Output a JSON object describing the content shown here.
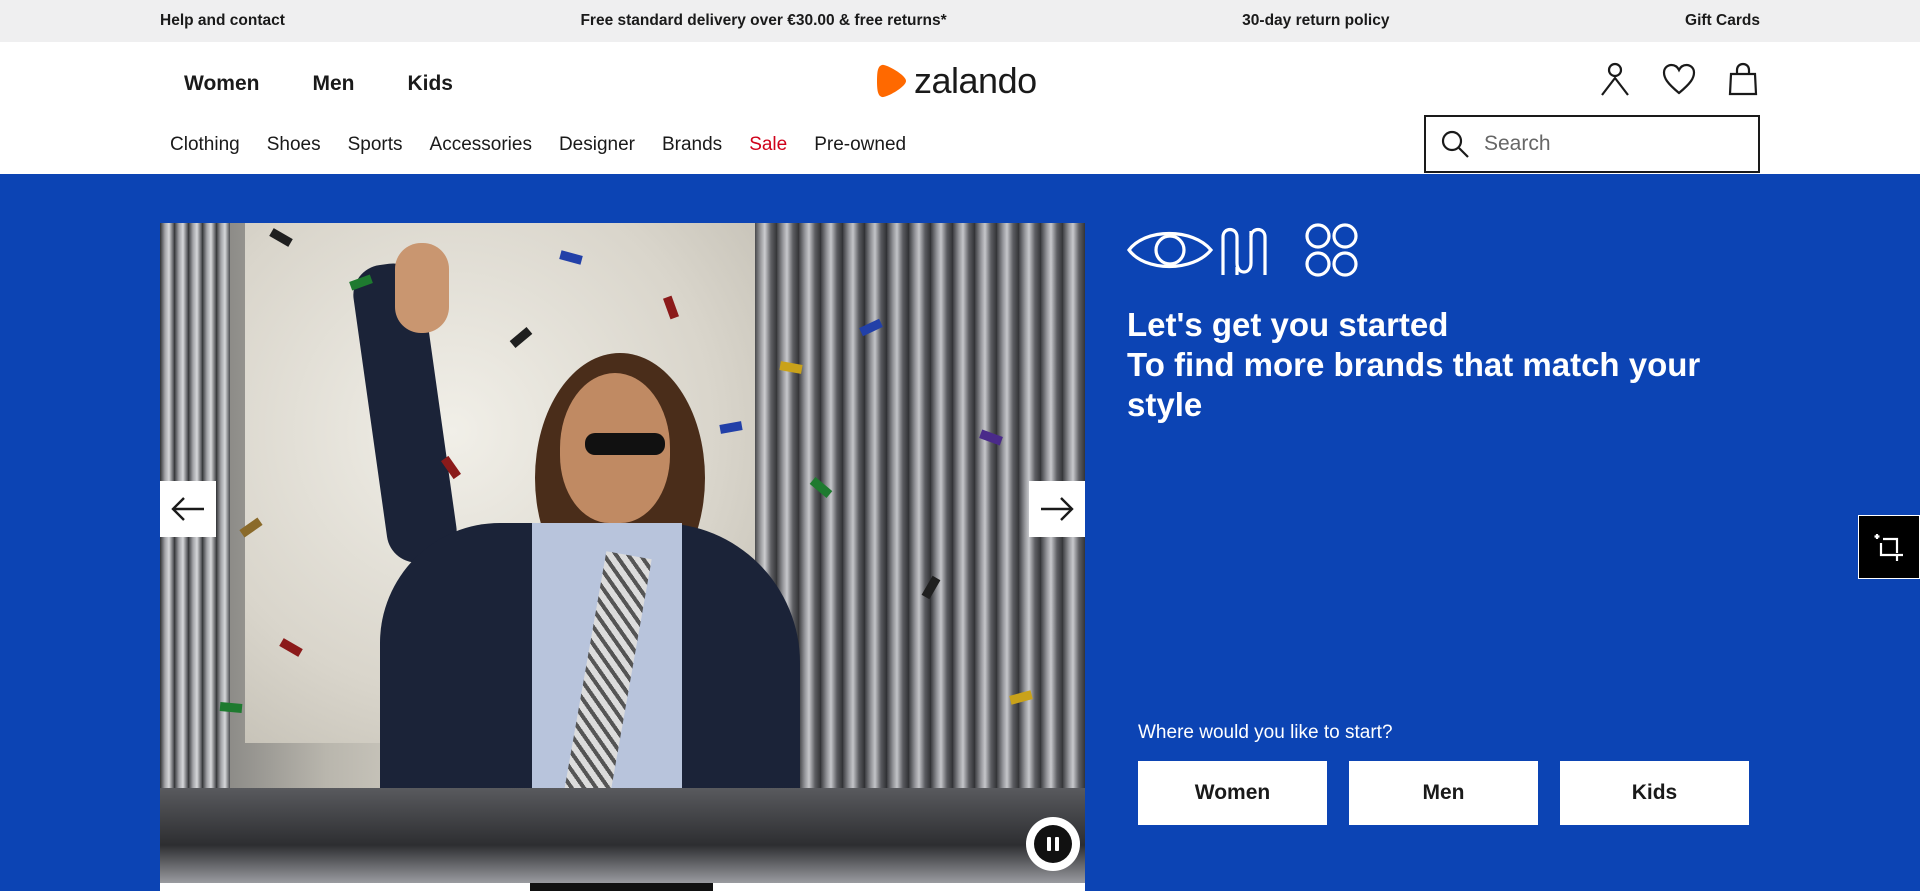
{
  "topbar": {
    "help": "Help and contact",
    "delivery": "Free standard delivery over €30.00 & free returns*",
    "returns": "30-day return policy",
    "gift_cards": "Gift Cards"
  },
  "header": {
    "gender_nav": [
      "Women",
      "Men",
      "Kids"
    ],
    "logo_text": "zalando",
    "logo_color": "#ff6900",
    "icons": [
      "account-icon",
      "wishlist-heart-icon",
      "shopping-bag-icon"
    ],
    "categories": [
      "Clothing",
      "Shoes",
      "Sports",
      "Accessories",
      "Designer",
      "Brands",
      "Sale",
      "Pre-owned"
    ],
    "sale_color": "#d0021b",
    "search_placeholder": "Search"
  },
  "hero": {
    "background_color": "#0c44b4",
    "headline_line1": "Let's get you started",
    "headline_line2": "To find more brands that match your",
    "headline_line3": "style",
    "start_label": "Where would you like to start?",
    "start_buttons": [
      "Women",
      "Men",
      "Kids"
    ],
    "carousel_controls": [
      "arrow-left-icon",
      "arrow-right-icon",
      "pause-icon"
    ]
  },
  "side_button": {
    "icon": "feedback-crop-icon"
  }
}
